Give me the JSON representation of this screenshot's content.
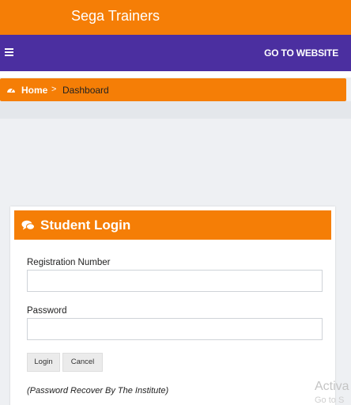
{
  "header": {
    "brand": "Sega Trainers"
  },
  "navbar": {
    "menu_icon": "hamburger-icon",
    "goto_website": "GO TO WEBSITE"
  },
  "breadcrumb": {
    "home_icon": "dashboard-gauge-icon",
    "home": "Home",
    "separator": ">",
    "current": "Dashboard"
  },
  "login": {
    "title_icon": "chat-bubbles-icon",
    "title": "Student Login",
    "registration_label": "Registration Number",
    "registration_value": "",
    "password_label": "Password",
    "password_value": "",
    "login_button": "Login",
    "cancel_button": "Cancel",
    "note": "(Password Recover By The Institute)"
  },
  "overlay": {
    "activate_line1": "Activa",
    "activate_line2": "Go to S"
  },
  "colors": {
    "orange": "#f57e06",
    "purple": "#4b2fa0"
  }
}
